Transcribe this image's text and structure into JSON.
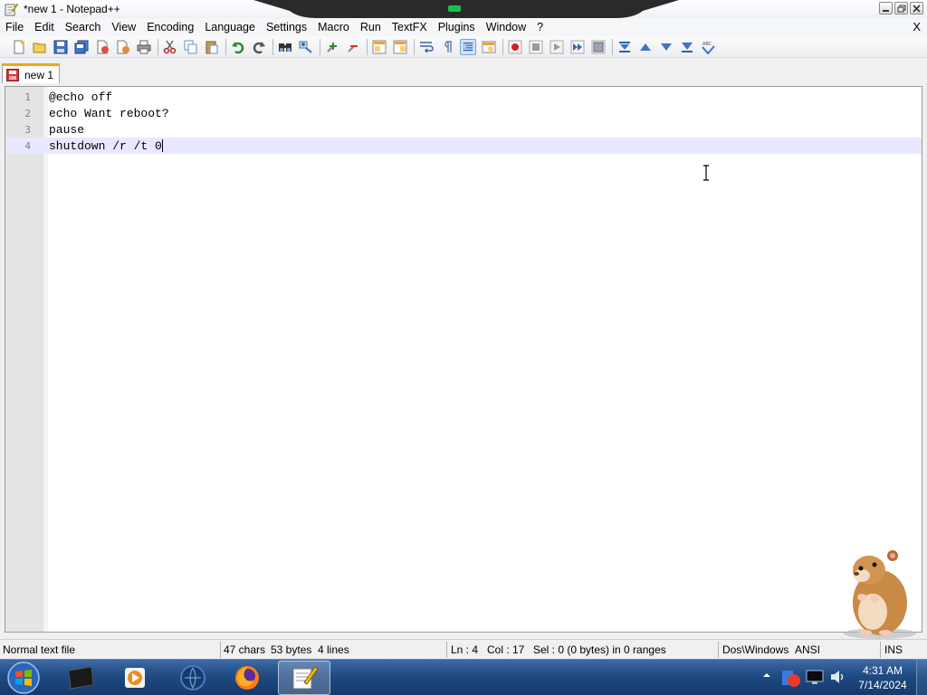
{
  "window": {
    "title": "*new 1 - Notepad++"
  },
  "menu": {
    "items": [
      "File",
      "Edit",
      "Search",
      "View",
      "Encoding",
      "Language",
      "Settings",
      "Macro",
      "Run",
      "TextFX",
      "Plugins",
      "Window",
      "?"
    ],
    "close_label": "X"
  },
  "toolbar": {
    "icons": [
      "new-file-icon",
      "open-file-icon",
      "save-icon",
      "save-all-icon",
      "close-icon",
      "close-all-icon",
      "print-icon",
      "cut-icon",
      "copy-icon",
      "paste-icon",
      "undo-icon",
      "redo-icon",
      "find-icon",
      "replace-icon",
      "zoom-in-icon",
      "zoom-out-icon",
      "sync-vertical-icon",
      "sync-horizontal-icon",
      "word-wrap-icon",
      "show-all-chars-icon",
      "indent-guide-icon",
      "doc-map-icon",
      "record-macro-icon",
      "stop-macro-icon",
      "play-macro-icon",
      "run-macro-multiple-icon",
      "save-macro-icon",
      "fold-all-icon",
      "prev-icon",
      "next-icon",
      "unfold-all-icon",
      "spellcheck-icon"
    ]
  },
  "tabs": [
    {
      "label": "new 1",
      "modified": true
    }
  ],
  "editor": {
    "lines": [
      {
        "num": "1",
        "text": "@echo off"
      },
      {
        "num": "2",
        "text": "echo Want reboot?"
      },
      {
        "num": "3",
        "text": "pause"
      },
      {
        "num": "4",
        "text": "shutdown /r /t 0"
      }
    ],
    "current_line": 4
  },
  "status": {
    "file_type": "Normal text file",
    "chars": "47 chars",
    "bytes": "53 bytes",
    "lines": "4 lines",
    "ln": "Ln : 4",
    "col": "Col : 17",
    "sel": "Sel : 0 (0 bytes) in 0 ranges",
    "eol": "Dos\\Windows",
    "encoding": "ANSI",
    "mode": "INS"
  },
  "taskbar": {
    "apps": [
      "media-center-icon",
      "media-player-icon",
      "internet-icon",
      "firefox-icon",
      "notepad-plus-plus-icon"
    ],
    "active_app": "notepad-plus-plus-icon",
    "time": "4:31 AM",
    "date": "7/14/2024"
  },
  "colors": {
    "tab_accent": "#f6a21c",
    "current_line_bg": "#e8e8ff",
    "taskbar": "#1f4a82"
  }
}
